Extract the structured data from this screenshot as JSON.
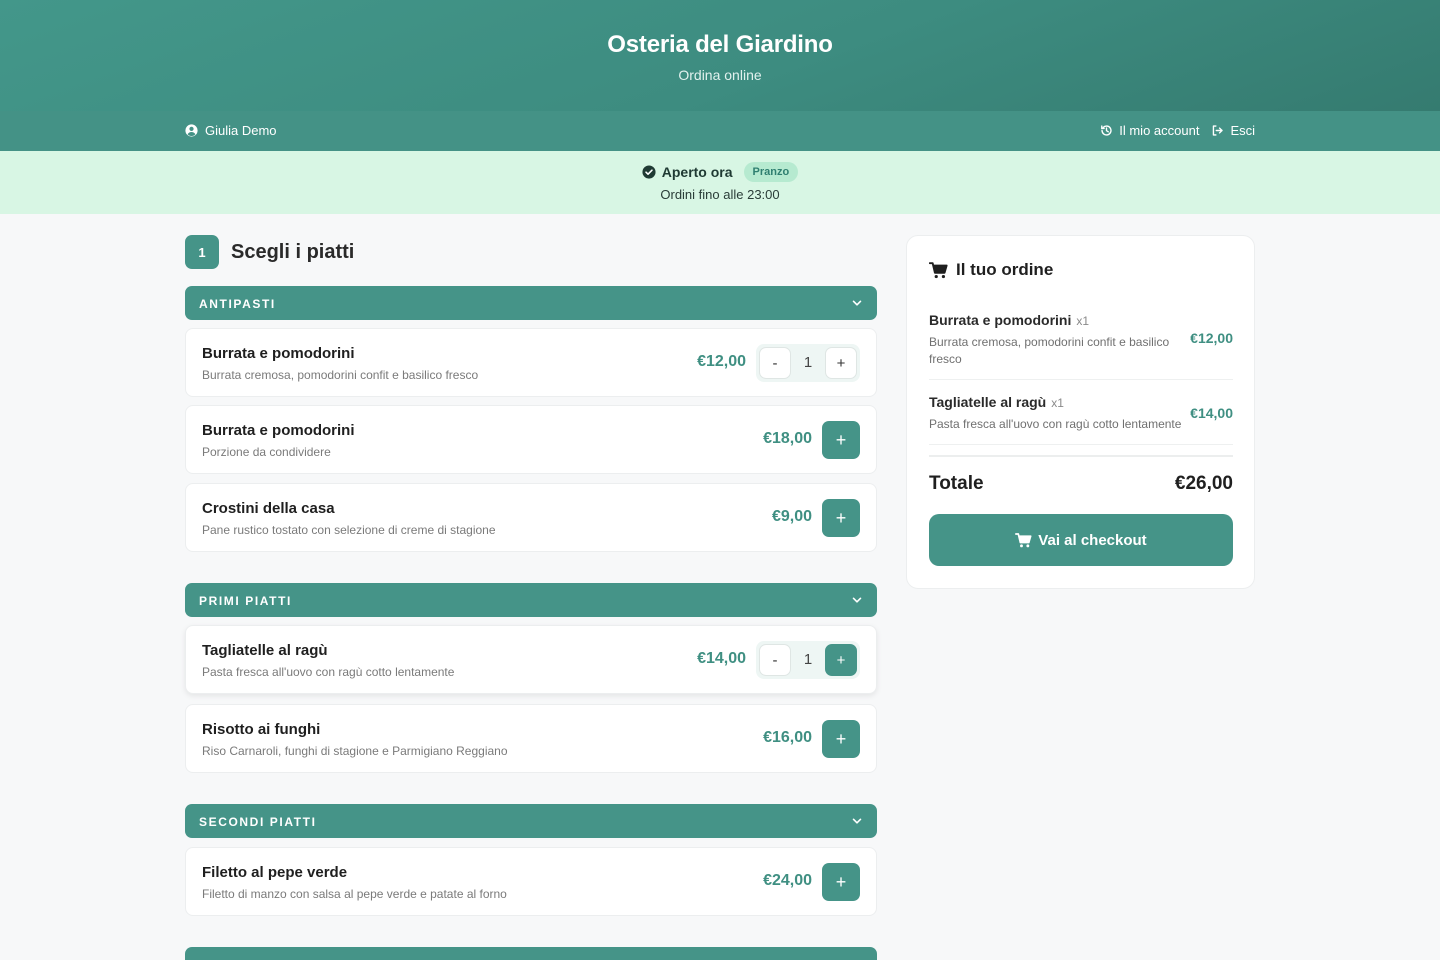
{
  "header": {
    "title": "Osteria del Giardino",
    "subtitle": "Ordina online"
  },
  "userbar": {
    "user_name": "Giulia Demo",
    "account_label": "Il mio account",
    "logout_label": "Esci"
  },
  "status": {
    "open_label": "Aperto ora",
    "badge": "Pranzo",
    "hours_text": "Ordini fino alle 23:00"
  },
  "step": {
    "number": "1",
    "label": "Scegli i piatti"
  },
  "menu": {
    "categories": [
      {
        "name": "ANTIPASTI"
      },
      {
        "name": "PRIMI PIATTI"
      },
      {
        "name": "SECONDI PIATTI"
      }
    ],
    "items": [
      {
        "name": "Burrata e pomodorini",
        "description": "Burrata cremosa, pomodorini confit e basilico fresco",
        "price": "€12,00",
        "quantity": "1"
      },
      {
        "name": "Burrata e pomodorini",
        "description": "Porzione da condividere",
        "price": "€18,00"
      },
      {
        "name": "Crostini della casa",
        "description": "Pane rustico tostato con selezione di creme di stagione",
        "price": "€9,00"
      },
      {
        "name": "Tagliatelle al ragù",
        "description": "Pasta fresca all'uovo con ragù cotto lentamente",
        "price": "€14,00",
        "quantity": "1"
      },
      {
        "name": "Risotto ai funghi",
        "description": "Riso Carnaroli, funghi di stagione e Parmigiano Reggiano",
        "price": "€16,00"
      },
      {
        "name": "Filetto al pepe verde",
        "description": "Filetto di manzo con salsa al pepe verde e patate al forno",
        "price": "€24,00"
      }
    ],
    "minus_label": "-",
    "plus_label": "+"
  },
  "order": {
    "title": "Il tuo ordine",
    "lines": [
      {
        "name": "Burrata e pomodorini",
        "qty": "x1",
        "description": "Burrata cremosa, pomodorini confit e basilico fresco",
        "price": "€12,00"
      },
      {
        "name": "Tagliatelle al ragù",
        "qty": "x1",
        "description": "Pasta fresca all'uovo con ragù cotto lentamente",
        "price": "€14,00"
      }
    ],
    "total_label": "Totale",
    "total_value": "€26,00",
    "checkout_label": "Vai al checkout"
  },
  "colors": {
    "brand": "#459488",
    "header_bg": "#3d8c80",
    "status_bg": "#d8f6e4",
    "price": "#3f8f82"
  },
  "icons": [
    "user-circle-icon",
    "history-icon",
    "logout-icon",
    "check-circle-icon",
    "chevron-down-icon",
    "cart-icon"
  ]
}
